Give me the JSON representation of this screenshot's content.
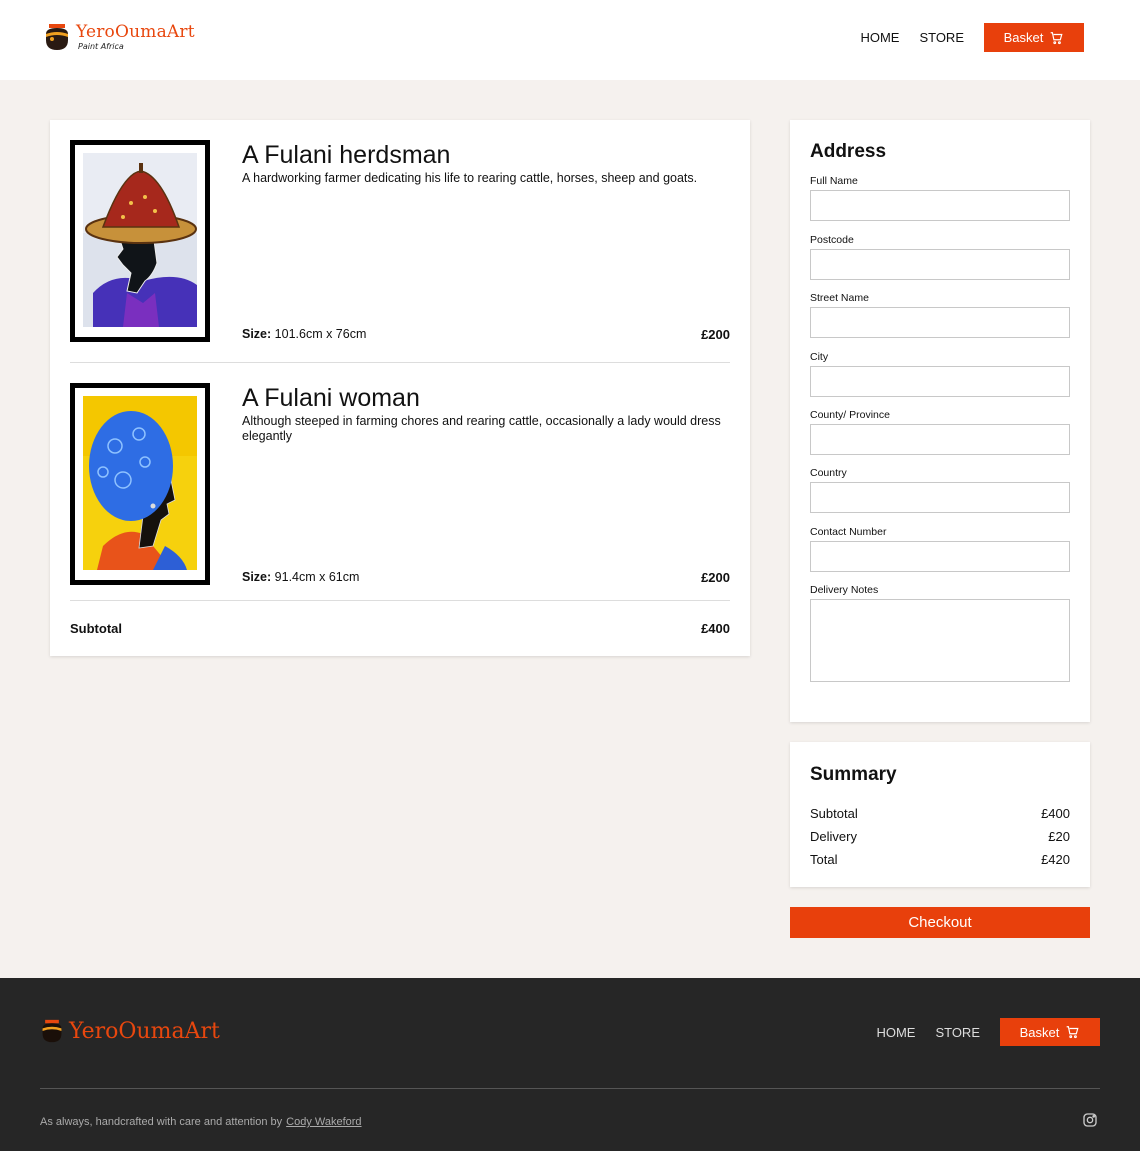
{
  "brand": {
    "name": "YeroOumaArt",
    "tagline": "Paint Africa"
  },
  "nav": {
    "home": "HOME",
    "store": "STORE",
    "basket": "Basket"
  },
  "basket": {
    "items": [
      {
        "title": "A Fulani herdsman",
        "description": "A hardworking farmer dedicating his life to rearing cattle, horses, sheep and goats.",
        "size_label": "Size:",
        "size": "101.6cm x 76cm",
        "price": "£200"
      },
      {
        "title": "A Fulani woman",
        "description": "Although steeped in farming chores and rearing cattle, occasionally a lady would dress elegantly",
        "size_label": "Size:",
        "size": "91.4cm x 61cm",
        "price": "£200"
      }
    ],
    "subtotal_label": "Subtotal",
    "subtotal": "£400"
  },
  "address": {
    "heading": "Address",
    "fields": {
      "full_name": "Full Name",
      "postcode": "Postcode",
      "street_name": "Street Name",
      "city": "City",
      "county": "County/ Province",
      "country": "Country",
      "contact_number": "Contact Number",
      "delivery_notes": "Delivery Notes"
    }
  },
  "summary": {
    "heading": "Summary",
    "subtotal_label": "Subtotal",
    "subtotal": "£400",
    "delivery_label": "Delivery",
    "delivery": "£20",
    "total_label": "Total",
    "total": "£420"
  },
  "checkout_label": "Checkout",
  "footer": {
    "credit": "As always, handcrafted with care and attention by",
    "author": "Cody Wakeford"
  },
  "colors": {
    "accent": "#e8400c",
    "page_bg": "#f5f1ee",
    "footer_bg": "#262626"
  }
}
